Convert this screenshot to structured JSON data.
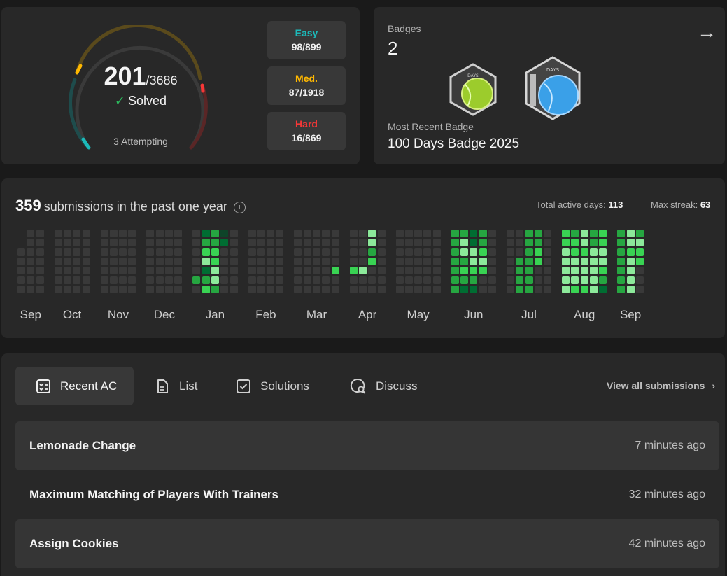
{
  "progress": {
    "solved": "201",
    "total": "/3686",
    "solved_label": "Solved",
    "attempting": "3 Attempting",
    "colors": {
      "easy": "#1cbaba",
      "medium": "#ffb800",
      "hard": "#f63737"
    },
    "difficulties": [
      {
        "label": "Easy",
        "value": "98/899"
      },
      {
        "label": "Med.",
        "value": "87/1918"
      },
      {
        "label": "Hard",
        "value": "16/869"
      }
    ]
  },
  "badges": {
    "title": "Badges",
    "count": "2",
    "recent_label": "Most Recent Badge",
    "recent_name": "100 Days Badge 2025",
    "badge_texts": [
      "DAYS",
      "DAYS"
    ]
  },
  "heatmap": {
    "count": "359",
    "count_label": "submissions in the past one year",
    "active_label": "Total active days:",
    "active_value": "113",
    "streak_label": "Max streak:",
    "streak_value": "63",
    "months": [
      "Sep",
      "Oct",
      "Nov",
      "Dec",
      "Jan",
      "Feb",
      "Mar",
      "Apr",
      "May",
      "Jun",
      "Jul",
      "Aug",
      "Sep"
    ],
    "level_colors": [
      "#393939",
      "#0e4429",
      "#006d32",
      "#26a641",
      "#39d353",
      "#8ce99a"
    ]
  },
  "recent": {
    "tabs": [
      {
        "label": "Recent AC",
        "icon": "checklist-icon"
      },
      {
        "label": "List",
        "icon": "document-icon"
      },
      {
        "label": "Solutions",
        "icon": "checkbox-icon"
      },
      {
        "label": "Discuss",
        "icon": "chat-search-icon"
      }
    ],
    "view_all": "View all submissions",
    "items": [
      {
        "title": "Lemonade Change",
        "time": "7 minutes ago"
      },
      {
        "title": "Maximum Matching of Players With Trainers",
        "time": "32 minutes ago"
      },
      {
        "title": "Assign Cookies",
        "time": "42 minutes ago"
      }
    ]
  }
}
